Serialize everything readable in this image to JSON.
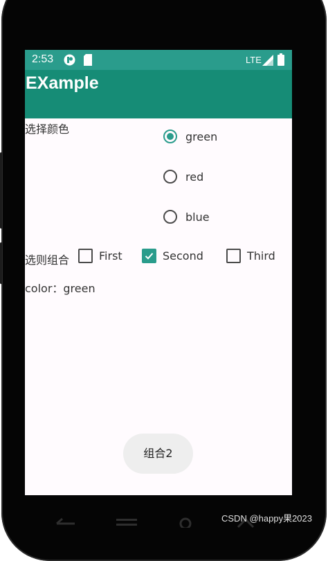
{
  "status_bar": {
    "time": "2:53",
    "network": "LTE",
    "icons": [
      "app-notification-icon",
      "sd-card-icon",
      "signal-icon",
      "battery-icon"
    ]
  },
  "app_bar": {
    "title": "EXample"
  },
  "color_group": {
    "label": "选择颜色",
    "options": [
      {
        "label": "green",
        "checked": true
      },
      {
        "label": "red",
        "checked": false
      },
      {
        "label": "blue",
        "checked": false
      }
    ]
  },
  "combo_group": {
    "label": "选则组合",
    "options": [
      {
        "label": "First",
        "checked": false
      },
      {
        "label": "Second",
        "checked": true
      },
      {
        "label": "Third",
        "checked": false
      }
    ]
  },
  "result_text": "color：green",
  "toast": "组合2",
  "nav": {
    "icons": [
      "back-icon",
      "home-icon",
      "menu-icon",
      "search-icon"
    ]
  },
  "watermark": "CSDN @happy果2023",
  "colors": {
    "status_bar": "#2a9c8c",
    "app_bar": "#168c76",
    "accent": "#2a9c8c",
    "screen_bg": "#fffbfe"
  }
}
